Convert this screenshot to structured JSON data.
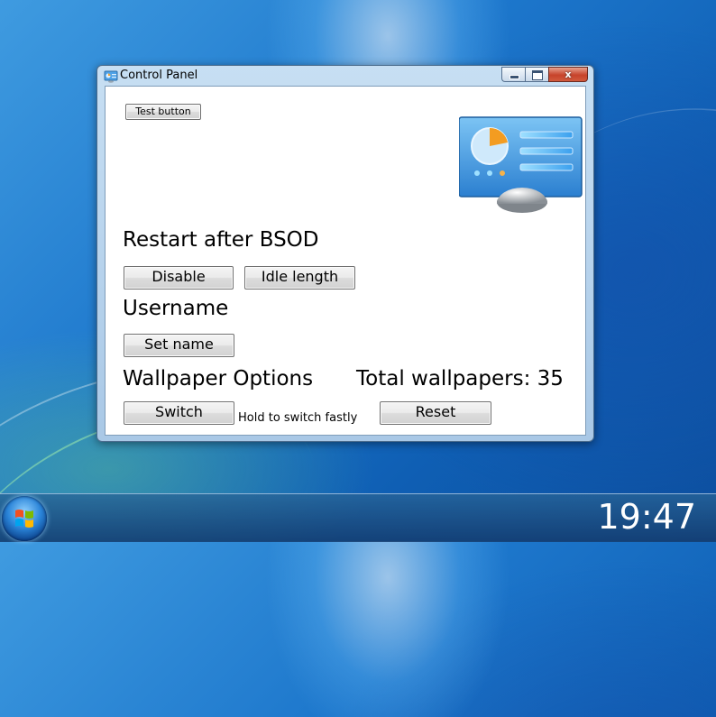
{
  "window": {
    "title": "Control Panel",
    "close_glyph": "x"
  },
  "controls": {
    "test_button": "Test button",
    "bsod_heading": "Restart after BSOD",
    "disable_button": "Disable",
    "idle_length_button": "Idle length",
    "username_heading": "Username",
    "set_name_button": "Set name",
    "wallpaper_heading": "Wallpaper Options",
    "total_wallpapers": "Total wallpapers: 35",
    "switch_button": "Switch",
    "hold_note": "Hold to switch fastly",
    "reset_button": "Reset"
  },
  "taskbar": {
    "clock": "19:47",
    "start_icon": "windows-logo-icon"
  },
  "colors": {
    "titlebar": "#c7dff3",
    "close": "#c7432b",
    "desktop": "#1d77cc"
  }
}
